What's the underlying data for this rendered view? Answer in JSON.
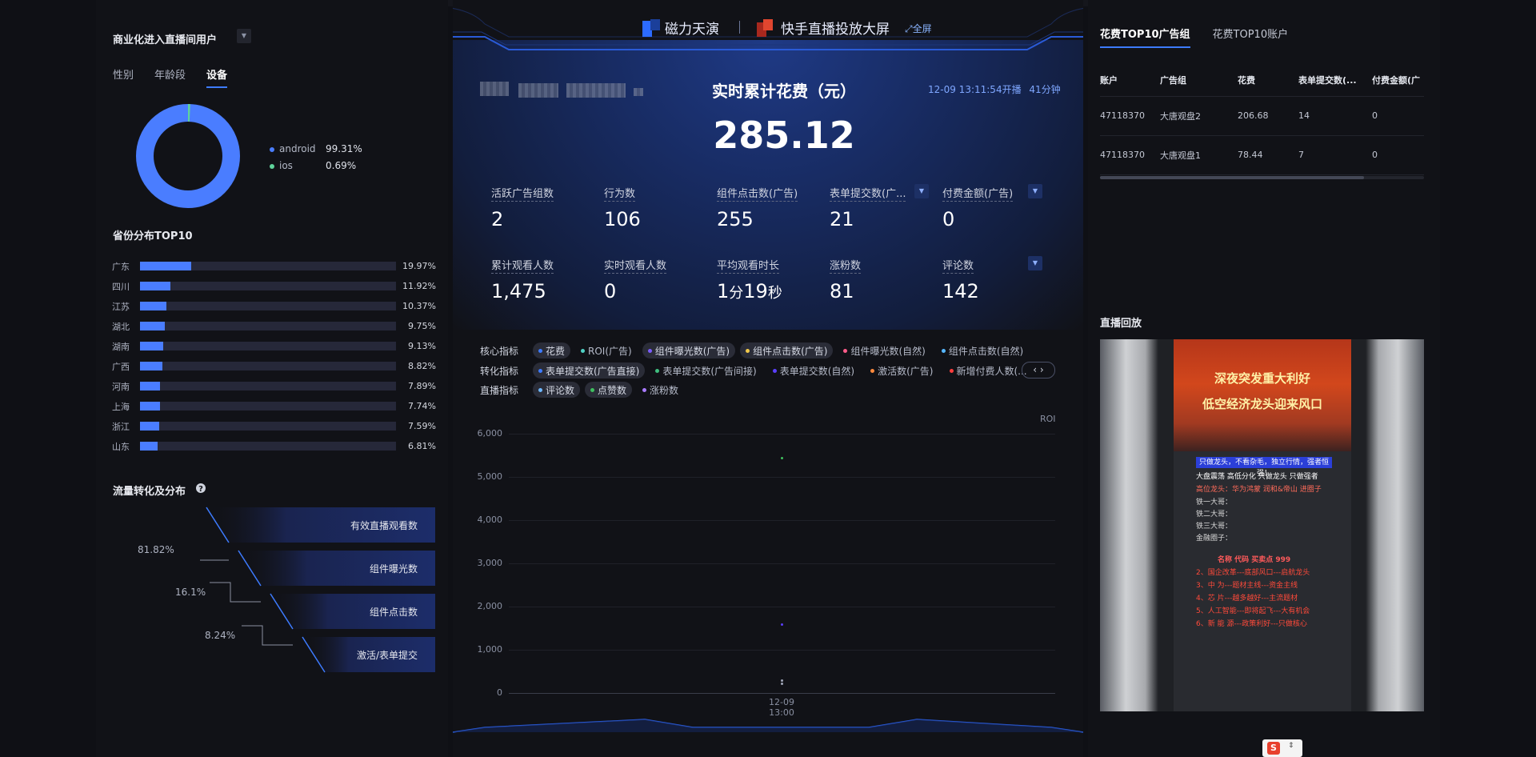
{
  "header": {
    "brand": "磁力天演",
    "title": "快手直播投放大屏",
    "fullscreen": "全屏"
  },
  "left": {
    "audience_title": "商业化进入直播间用户",
    "tabs": [
      "性别",
      "年龄段",
      "设备"
    ],
    "active_tab": "设备",
    "device_legend": [
      {
        "name": "android",
        "pct": "99.31%",
        "color": "#4a7dff",
        "value": 99.31
      },
      {
        "name": "ios",
        "pct": "0.69%",
        "color": "#5fd39b",
        "value": 0.69
      }
    ],
    "province_title": "省份分布TOP10",
    "provinces": [
      {
        "name": "广东",
        "pct": "19.97%",
        "value": 19.97
      },
      {
        "name": "四川",
        "pct": "11.92%",
        "value": 11.92
      },
      {
        "name": "江苏",
        "pct": "10.37%",
        "value": 10.37
      },
      {
        "name": "湖北",
        "pct": "9.75%",
        "value": 9.75
      },
      {
        "name": "湖南",
        "pct": "9.13%",
        "value": 9.13
      },
      {
        "name": "广西",
        "pct": "8.82%",
        "value": 8.82
      },
      {
        "name": "河南",
        "pct": "7.89%",
        "value": 7.89
      },
      {
        "name": "上海",
        "pct": "7.74%",
        "value": 7.74
      },
      {
        "name": "浙江",
        "pct": "7.59%",
        "value": 7.59
      },
      {
        "name": "山东",
        "pct": "6.81%",
        "value": 6.81
      }
    ],
    "funnel_title": "流量转化及分布",
    "funnel_steps": [
      "有效直播观看数",
      "组件曝光数",
      "组件点击数",
      "激活/表单提交"
    ],
    "conversions": [
      "81.82%",
      "16.1%",
      "8.24%"
    ]
  },
  "center": {
    "live_start": "12-09 13:11:54开播",
    "live_duration": "41分钟",
    "spend_title": "实时累计花费（元）",
    "spend_value": "285.12",
    "metrics_row1": [
      {
        "label": "活跃广告组数",
        "value": "2"
      },
      {
        "label": "行为数",
        "value": "106"
      },
      {
        "label": "组件点击数(广告)",
        "value": "255"
      },
      {
        "label": "表单提交数(广...",
        "value": "21"
      },
      {
        "label": "付费金额(广告)",
        "value": "0"
      }
    ],
    "metrics_row2": [
      {
        "label": "累计观看人数",
        "value": "1,475"
      },
      {
        "label": "实时观看人数",
        "value": "0"
      },
      {
        "label": "平均观看时长",
        "value_main": "1",
        "value_u1": "分",
        "value_mid": "19",
        "value_u2": "秒"
      },
      {
        "label": "涨粉数",
        "value": "81"
      },
      {
        "label": "评论数",
        "value": "142"
      }
    ],
    "indicator_rows": [
      {
        "caption": "核心指标",
        "chips": [
          {
            "label": "花费",
            "color": "#3d7bff",
            "on": true
          },
          {
            "label": "ROI(广告)",
            "color": "#4fd1c5",
            "on": false
          },
          {
            "label": "组件曝光数(广告)",
            "color": "#7b5cff",
            "on": true
          },
          {
            "label": "组件点击数(广告)",
            "color": "#f2c94c",
            "on": true
          },
          {
            "label": "组件曝光数(自然)",
            "color": "#ff5c8a",
            "on": false
          },
          {
            "label": "组件点击数(自然)",
            "color": "#56b7ff",
            "on": false
          }
        ]
      },
      {
        "caption": "转化指标",
        "chips": [
          {
            "label": "表单提交数(广告直接)",
            "color": "#3d7bff",
            "on": true
          },
          {
            "label": "表单提交数(广告间接)",
            "color": "#3fbf7f",
            "on": false
          },
          {
            "label": "表单提交数(自然)",
            "color": "#5b3fff",
            "on": false
          },
          {
            "label": "激活数(广告)",
            "color": "#ff8a3d",
            "on": false
          },
          {
            "label": "新增付费人数(...",
            "color": "#ff3d3d",
            "on": false
          }
        ]
      },
      {
        "caption": "直播指标",
        "chips": [
          {
            "label": "评论数",
            "color": "#6fb8ff",
            "on": true
          },
          {
            "label": "点赞数",
            "color": "#3fbf5f",
            "on": true
          },
          {
            "label": "涨粉数",
            "color": "#a97bff",
            "on": false
          }
        ]
      }
    ],
    "nav": "‹ ›"
  },
  "chart_data": {
    "type": "scatter",
    "title": "",
    "xlabel": "",
    "ylabel": "",
    "right_axis_label": "ROI",
    "x": [
      "12-09\n13:00"
    ],
    "x_tick_date": "12-09",
    "x_tick_time": "13:00",
    "y_ticks": [
      "6,000",
      "5,000",
      "4,000",
      "3,000",
      "2,000",
      "1,000",
      "0"
    ],
    "ylim": [
      0,
      6000
    ],
    "points": [
      {
        "x": "12-09 13:00",
        "y": 5450,
        "color": "#3fbf5f"
      },
      {
        "x": "12-09 13:00",
        "y": 1600,
        "color": "#5b3fff"
      },
      {
        "x": "12-09 13:00",
        "y": 290,
        "color": "#a0a6b8"
      },
      {
        "x": "12-09 13:00",
        "y": 220,
        "color": "#a0a6b8"
      }
    ],
    "grid": true
  },
  "right": {
    "tabs": [
      "花费TOP10广告组",
      "花费TOP10账户"
    ],
    "active_tab": "花费TOP10广告组",
    "columns": [
      "账户",
      "广告组",
      "花费",
      "表单提交数(...",
      "付费金额(广"
    ],
    "rows": [
      [
        "47118370",
        "大唐观盘2",
        "206.68",
        "14",
        "0"
      ],
      [
        "47118370",
        "大唐观盘1",
        "78.44",
        "7",
        "0"
      ]
    ],
    "replay_title": "直播回放",
    "poster": {
      "headline1": "深夜突发重大利好",
      "headline2": "低空经济龙头迎来风口",
      "subline": "只做龙头，不看杂毛，独立行情，强者恒强！",
      "l1": "大盘震荡   高低分化  只做龙头  只做强者",
      "l2": "高位龙头：华为鸿蒙 润和&帝山   进圈子",
      "l3": "铁一大哥：",
      "l4": "铁二大哥：",
      "l5": "铁三大哥：",
      "l6": "金融圈子：",
      "l7": "名称  代码  买卖点   999",
      "l8": "2、国企改革---底部风口---启航龙头",
      "l9": "3、中    为---题材主线---资金主线",
      "l10": "4、芯    片---越多越好---主流题材",
      "l11": "5、人工智能---即将起飞---大有机会",
      "l12": "6、新 能 源---政策利好---只做核心"
    }
  }
}
